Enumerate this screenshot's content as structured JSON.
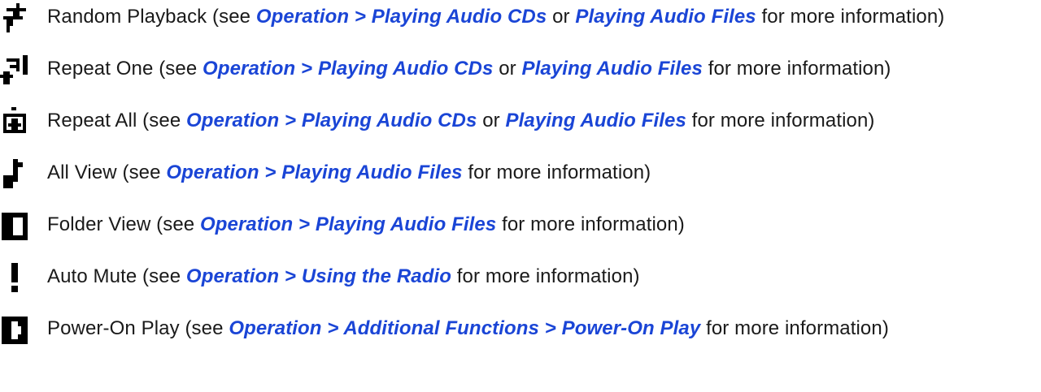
{
  "items": [
    {
      "icon": "random-playback-icon",
      "label": "Random Playback (see ",
      "link1": "Operation > Playing Audio CDs",
      "between": " or ",
      "link2": "Playing Audio Files",
      "suffix": " for more information)"
    },
    {
      "icon": "repeat-one-icon",
      "label": "Repeat One (see ",
      "link1": "Operation > Playing Audio CDs",
      "between": " or ",
      "link2": "Playing Audio Files",
      "suffix": " for more information)"
    },
    {
      "icon": "repeat-all-icon",
      "label": "Repeat All (see ",
      "link1": "Operation > Playing Audio CDs",
      "between": " or ",
      "link2": "Playing Audio Files",
      "suffix": " for more information)"
    },
    {
      "icon": "all-view-icon",
      "label": "All View (see ",
      "link1": "Operation > Playing Audio Files",
      "suffix": " for more information)"
    },
    {
      "icon": "folder-view-icon",
      "label": "Folder View (see ",
      "link1": "Operation > Playing Audio Files",
      "suffix": " for more information)"
    },
    {
      "icon": "auto-mute-icon",
      "label": "Auto Mute (see ",
      "link1": "Operation > Using the Radio",
      "suffix": " for more information)"
    },
    {
      "icon": "power-on-play-icon",
      "label": "Power-On Play (see ",
      "link1": "Operation > Additional Functions > Power-On Play",
      "suffix": " for more information)"
    }
  ],
  "colors": {
    "link": "#1a45d6",
    "text": "#1a1a1a",
    "icon": "#000000"
  }
}
